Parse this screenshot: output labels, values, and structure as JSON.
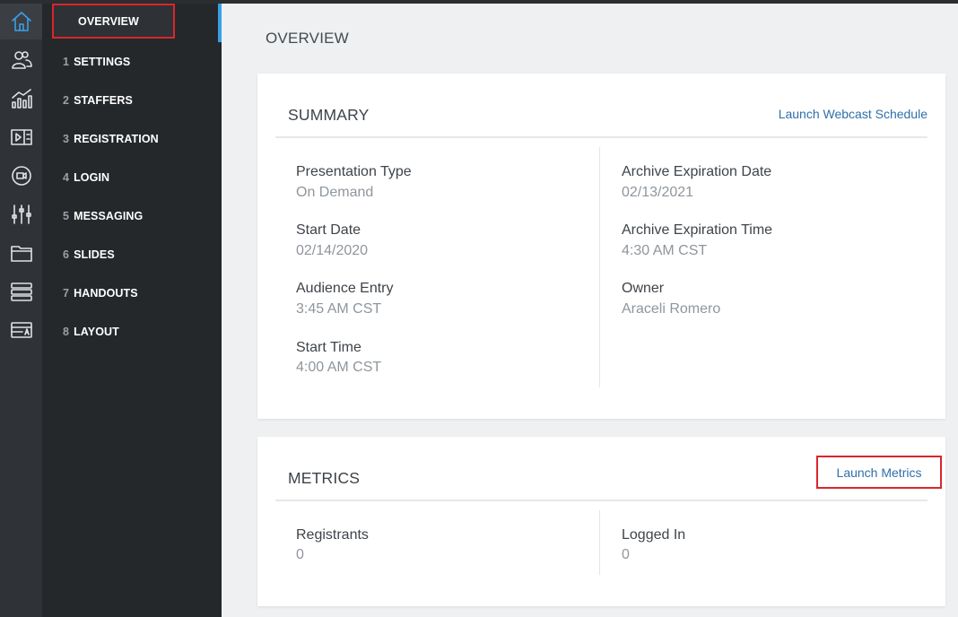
{
  "nav": {
    "overview": "OVERVIEW",
    "steps": [
      {
        "num": "1",
        "label": "SETTINGS"
      },
      {
        "num": "2",
        "label": "STAFFERS"
      },
      {
        "num": "3",
        "label": "REGISTRATION"
      },
      {
        "num": "4",
        "label": "LOGIN"
      },
      {
        "num": "5",
        "label": "MESSAGING"
      },
      {
        "num": "6",
        "label": "SLIDES"
      },
      {
        "num": "7",
        "label": "HANDOUTS"
      },
      {
        "num": "8",
        "label": "LAYOUT"
      }
    ]
  },
  "rail": [
    "home-icon",
    "users-icon",
    "analytics-icon",
    "media-icon",
    "video-icon",
    "sliders-icon",
    "folder-icon",
    "list-icon",
    "id-card-icon"
  ],
  "page": {
    "title": "OVERVIEW"
  },
  "summary": {
    "title": "SUMMARY",
    "link": "Launch Webcast Schedule",
    "left": [
      {
        "label": "Presentation Type",
        "value": "On Demand"
      },
      {
        "label": "Start Date",
        "value": "02/14/2020"
      },
      {
        "label": "Audience Entry",
        "value": "3:45 AM CST"
      },
      {
        "label": "Start Time",
        "value": "4:00 AM CST"
      }
    ],
    "right": [
      {
        "label": "Archive Expiration Date",
        "value": "02/13/2021"
      },
      {
        "label": "Archive Expiration Time",
        "value": "4:30 AM CST"
      },
      {
        "label": "Owner",
        "value": "Araceli Romero"
      }
    ]
  },
  "metrics": {
    "title": "METRICS",
    "link": "Launch Metrics",
    "left": {
      "label": "Registrants",
      "value": "0"
    },
    "right": {
      "label": "Logged In",
      "value": "0"
    }
  },
  "colors": {
    "accent": "#3aa0e6",
    "link": "#2f6fa8",
    "highlight": "#d9262b"
  }
}
